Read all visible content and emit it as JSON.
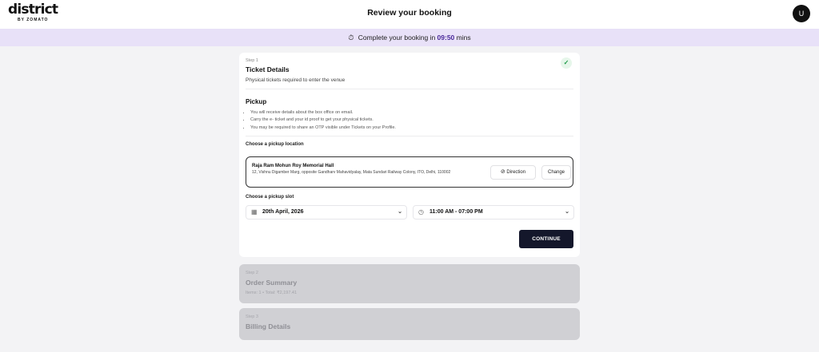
{
  "header": {
    "logo_text": "district",
    "logo_sub": "BY ZOMATO",
    "title": "Review your booking",
    "avatar_initial": "U"
  },
  "timer": {
    "prefix": "Complete your booking in",
    "time": "09:50",
    "suffix": "mins"
  },
  "step1": {
    "step_label": "Step 1",
    "title": "Ticket Details",
    "subtitle": "Physical tickets required to enter the venue",
    "pickup": {
      "heading": "Pickup",
      "bullets": [
        "You will receive details about the box office on email.",
        "Carry the e- ticket and your id proof to get your physical tickets.",
        "You may be required to share an OTP visible under Tickets on your Profile."
      ]
    },
    "location_label": "Choose a pickup location",
    "venue": {
      "name": "Raja Ram Mohun Roy Memorial Hall",
      "address": "12, Vishnu Digamber Marg, opposite Gandharv Mahavidyalay, Mata Sundari Railway Colony, ITO, Delhi, 110002",
      "direction_label": "Direction",
      "change_label": "Change"
    },
    "slot_label": "Choose a pickup slot",
    "date_value": "20th April, 2026",
    "time_value": "11:00 AM - 07:00 PM",
    "continue_label": "CONTINUE"
  },
  "step2": {
    "step_label": "Step 2",
    "title": "Order Summary",
    "subtitle": "Items: 1 • Total: ₹2,197.41"
  },
  "step3": {
    "step_label": "Step 3",
    "title": "Billing Details"
  },
  "colors": {
    "timer_bg": "#e8e1f8",
    "accent_time": "#4a2a9a",
    "continue_bg": "#14172b",
    "check_green": "#1e9a48"
  },
  "icons": {
    "timer": "stopwatch-icon",
    "check": "check-icon",
    "direction": "navigation-arrow-icon",
    "calendar": "calendar-icon",
    "clock": "clock-icon",
    "chevron": "chevron-down-icon"
  }
}
